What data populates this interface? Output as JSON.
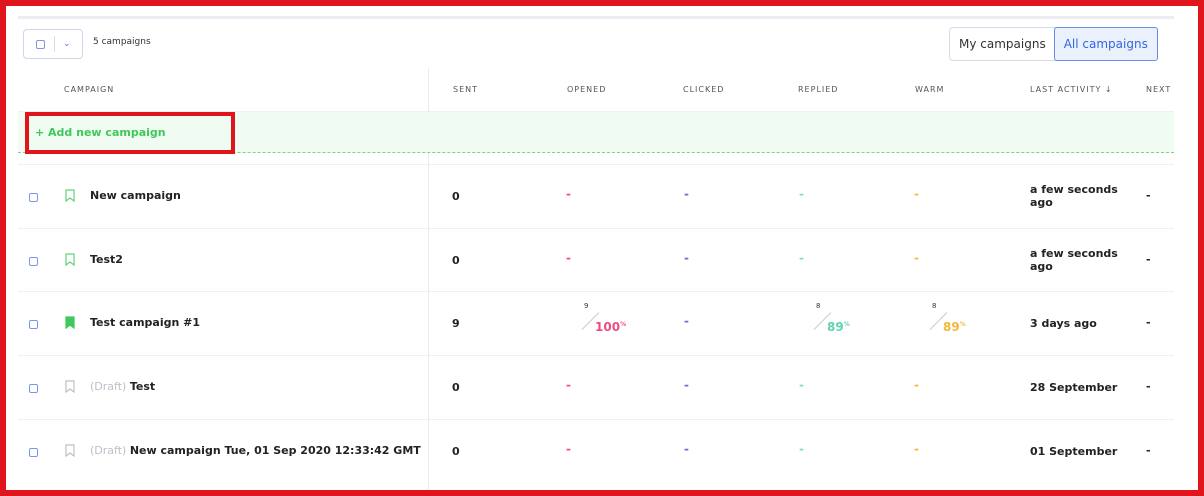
{
  "toolbar": {
    "count_label": "5 campaigns",
    "my_campaigns": "My campaigns",
    "all_campaigns": "All campaigns"
  },
  "columns": {
    "campaign": "CAMPAIGN",
    "sent": "SENT",
    "opened": "OPENED",
    "clicked": "CLICKED",
    "replied": "REPLIED",
    "warm": "WARM",
    "last_activity": "LAST ACTIVITY ↓",
    "next": "NEXT"
  },
  "add_campaign": "+ Add new campaign",
  "rows": [
    {
      "draft": "",
      "name": "New campaign",
      "sent": "0",
      "opened": "-",
      "clicked": "-",
      "replied": "-",
      "warm": "-",
      "last_activity": "a few seconds ago",
      "next": "-",
      "bookmark": "bookmark-outline-icon"
    },
    {
      "draft": "",
      "name": "Test2",
      "sent": "0",
      "opened": "-",
      "clicked": "-",
      "replied": "-",
      "warm": "-",
      "last_activity": "a few seconds ago",
      "next": "-",
      "bookmark": "bookmark-outline-icon"
    },
    {
      "draft": "",
      "name": "Test campaign #1",
      "sent": "9",
      "opened_count": "9",
      "opened_pct": "100",
      "clicked": "-",
      "replied_count": "8",
      "replied_pct": "89",
      "warm_count": "8",
      "warm_pct": "89",
      "last_activity": "3 days ago",
      "next": "-",
      "bookmark": "bookmark-filled-icon"
    },
    {
      "draft": "(Draft) ",
      "name": "Test",
      "sent": "0",
      "opened": "-",
      "clicked": "-",
      "replied": "-",
      "warm": "-",
      "last_activity": "28 September",
      "next": "-",
      "bookmark": "bookmark-outline-icon"
    },
    {
      "draft": "(Draft) ",
      "name": "New campaign Tue, 01 Sep 2020 12:33:42 GMT",
      "sent": "0",
      "opened": "-",
      "clicked": "-",
      "replied": "-",
      "warm": "-",
      "last_activity": "01 September",
      "next": "-",
      "bookmark": "bookmark-outline-icon"
    }
  ],
  "percent_sign": "%",
  "colors": {
    "opened": "#ee4b82",
    "clicked": "#5f6fe0",
    "replied": "#5ed3b3",
    "warm": "#f5b73a",
    "add_green": "#3ec95a",
    "highlight_red": "#e0151b"
  }
}
